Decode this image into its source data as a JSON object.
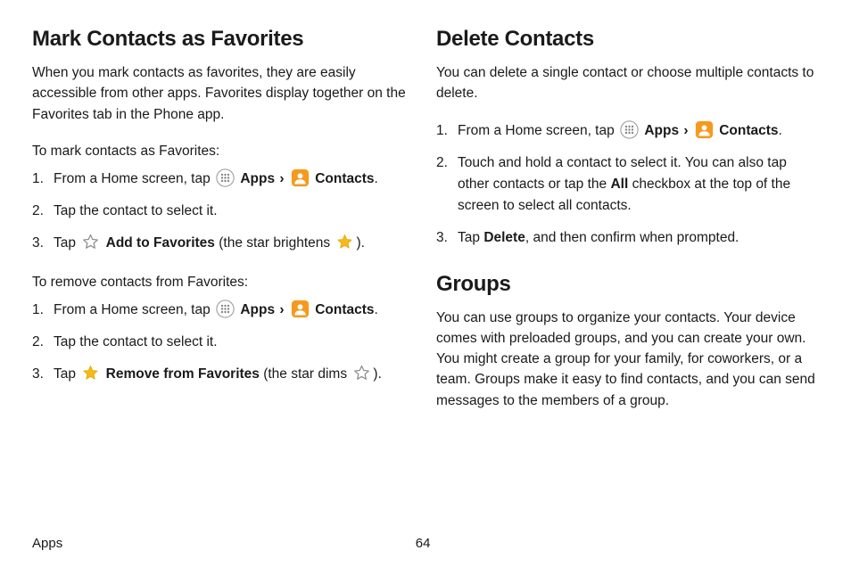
{
  "left": {
    "heading": "Mark Contacts as Favorites",
    "intro": "When you mark contacts as favorites, they are easily accessible from other apps. Favorites display together on the Favorites tab in the Phone app.",
    "lead1": "To mark contacts as Favorites:",
    "steps1": {
      "s1_pre": "From a Home screen, tap ",
      "s1_apps": "Apps",
      "s1_chev": "›",
      "s1_contacts": "Contacts",
      "s1_end": ".",
      "s2": "Tap the contact to select it.",
      "s3_pre": "Tap ",
      "s3_bold": "Add to Favorites",
      "s3_mid": " (the star brightens ",
      "s3_end": ")."
    },
    "lead2": "To remove contacts from Favorites:",
    "steps2": {
      "s1_pre": "From a Home screen, tap ",
      "s1_apps": "Apps",
      "s1_chev": "›",
      "s1_contacts": "Contacts",
      "s1_end": ".",
      "s2": "Tap the contact to select it.",
      "s3_pre": "Tap ",
      "s3_bold": "Remove from Favorites",
      "s3_mid": " (the star dims ",
      "s3_end": ")."
    }
  },
  "right": {
    "heading1": "Delete Contacts",
    "intro1": "You can delete a single contact or choose multiple contacts to delete.",
    "steps": {
      "s1_pre": "From a Home screen, tap ",
      "s1_apps": "Apps",
      "s1_chev": "›",
      "s1_contacts": "Contacts",
      "s1_end": ".",
      "s2_pre": "Touch and hold a contact to select it. You can also tap other contacts or tap the ",
      "s2_bold": "All",
      "s2_post": " checkbox at the top of the screen to select all contacts.",
      "s3_pre": "Tap ",
      "s3_bold": "Delete",
      "s3_post": ", and then confirm when prompted."
    },
    "heading2": "Groups",
    "intro2": "You can use groups to organize your contacts. Your device comes with preloaded groups, and you can create your own. You might create a group for your family, for coworkers, or a team. Groups make it easy to find contacts, and you can send messages to the members of a group."
  },
  "footer": {
    "section": "Apps",
    "page": "64"
  }
}
